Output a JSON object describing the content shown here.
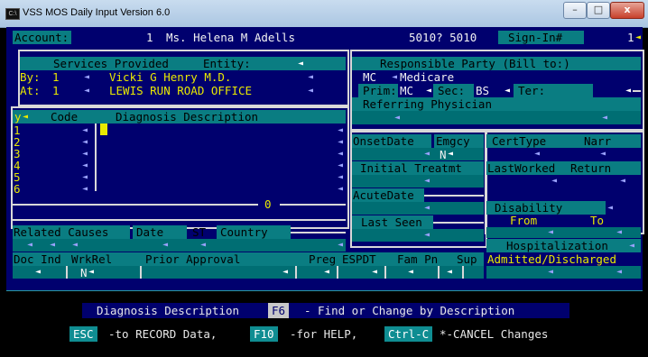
{
  "window": {
    "title": "VSS MOS Daily Input Version 6.0",
    "minimize": "–",
    "maximize": "□",
    "close": "x",
    "app_icon_text": "C:\\"
  },
  "account": {
    "label": "Account:",
    "number": "1",
    "patient": "Ms. Helena M Adells",
    "zip": "5010? 5010",
    "signin_label": "Sign-In#",
    "signin_value": "1"
  },
  "services": {
    "heading": "Services Provided",
    "entity_label": "Entity:",
    "by_label": "By:",
    "by_id": "1",
    "by_name": "Vicki G Henry M.D.",
    "at_label": "At:",
    "at_id": "1",
    "at_name": "LEWIS RUN ROAD OFFICE"
  },
  "responsible": {
    "heading": "Responsible Party (Bill to:)",
    "type": "MC",
    "name": "Medicare",
    "prim_label": "Prim:",
    "prim_value": "MC",
    "sec_label": "Sec:",
    "sec_value": "BS",
    "ter_label": "Ter:",
    "referring_label": "Referring Physician"
  },
  "diagnosis": {
    "y_label": "y",
    "code_header": "Code",
    "desc_header": "Diagnosis Description",
    "rows": [
      "1",
      "2",
      "3",
      "4",
      "5",
      "6"
    ],
    "counter": "0"
  },
  "onset": {
    "onset_label": "OnsetDate",
    "emgcy_label": "Emgcy",
    "emgcy_value": "N",
    "initial_label": "Initial Treatmt",
    "acute_label": "AcuteDate",
    "last_seen_label": "Last Seen"
  },
  "cert": {
    "certtype_label": "CertType",
    "narr_label": "Narr",
    "lastworked_label": "LastWorked",
    "return_label": "Return",
    "disability_label": "Disability",
    "from_label": "From",
    "to_label": "To",
    "hospital_label": "Hospitalization",
    "admitted_label": "Admitted/Discharged"
  },
  "related": {
    "related_label": "Related Causes",
    "date_label": "Date",
    "st_label": "ST",
    "country_label": "Country"
  },
  "doc": {
    "docind_label": "Doc Ind",
    "wrkrel_label": "WrkRel",
    "wrkrel_value": "N",
    "prior_label": "Prior Approval",
    "preg_label": "Preg",
    "espdt_label": "ESPDT",
    "fampn_label": "Fam Pn",
    "sup_label": "Sup"
  },
  "help": {
    "desc_label": "Diagnosis Description",
    "f6_key": "F6",
    "f6_text": "- Find or Change by Description",
    "esc_key": "ESC",
    "esc_text": "-to RECORD Data,",
    "f10_key": "F10",
    "f10_text": "-for HELP,",
    "ctrlc_key": "Ctrl-C",
    "ctrlc_text": "*-CANCEL Changes"
  },
  "colors": {
    "console_bg": "#00006e",
    "field_bar": "#0a7d82",
    "highlight": "#e9e900",
    "text": "#c8c8c8"
  }
}
